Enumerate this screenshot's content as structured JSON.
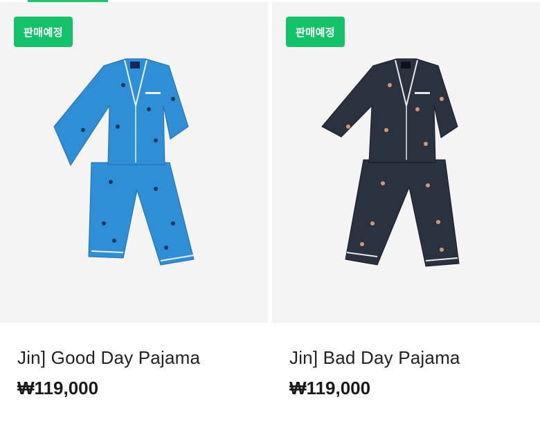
{
  "products": [
    {
      "badge": "판매예정",
      "name": "Jin] Good Day Pajama",
      "price": "₩119,000",
      "colors": {
        "fabric": "#2f8fd6",
        "fabric_dark": "#1f6fae",
        "piping": "#e8f1f8"
      }
    },
    {
      "badge": "판매예정",
      "name": "Jin] Bad Day Pajama",
      "price": "₩119,000",
      "colors": {
        "fabric": "#2a3240",
        "fabric_dark": "#161c26",
        "piping": "#e9e9ec"
      }
    }
  ],
  "accent_color": "#14c26a"
}
